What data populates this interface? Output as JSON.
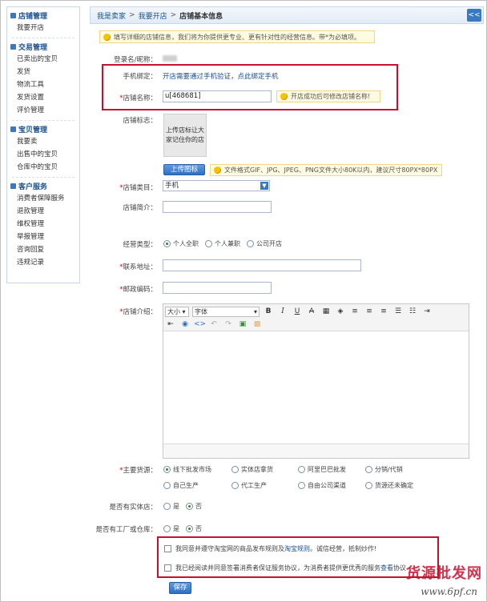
{
  "sidebar": {
    "groups": [
      {
        "title": "店铺管理",
        "items": [
          "我要开店"
        ]
      },
      {
        "title": "交易管理",
        "items": [
          "已卖出的宝贝",
          "发货",
          "物流工具",
          "发货设置",
          "评价管理"
        ]
      },
      {
        "title": "宝贝管理",
        "items": [
          "我要卖",
          "出售中的宝贝",
          "仓库中的宝贝"
        ]
      },
      {
        "title": "客户服务",
        "items": [
          "消费者保障服务",
          "退款管理",
          "维权管理",
          "举报管理",
          "咨询回复",
          "违规记录"
        ]
      }
    ]
  },
  "breadcrumb": {
    "items": [
      "我是卖家",
      "我要开店"
    ],
    "current": "店铺基本信息",
    "separator": ">"
  },
  "collapse_label": "<<",
  "top_tip": "填写详细的店铺信息，我们将为你提供更专业、更有针对性的经营信息。带*为必填项。",
  "form": {
    "login_label": "登录名/昵称：",
    "login_value": "",
    "phone_label": "手机绑定：",
    "phone_text": "开店需要通过手机验证，点此绑定手机",
    "shop_name_label": "店铺名称：",
    "shop_name_value": "u[468681]",
    "shop_name_tip": "开店成功后可修改店铺名称!",
    "logo_label": "店铺标志：",
    "logo_box_text": "上传店标让大家记住你的店",
    "upload_button": "上传图标",
    "upload_tip": "文件格式GIF、JPG、JPEG、PNG文件大小80K以内，建议尺寸80PX*80PX",
    "category_label": "店铺类目：",
    "category_value": "手机",
    "intro_short_label": "店铺简介：",
    "business_type_label": "经营类型：",
    "business_types": [
      "个人全职",
      "个人兼职",
      "公司开店"
    ],
    "address_label": "联系地址：",
    "zip_label": "邮政编码：",
    "shop_intro_label": "店铺介绍：",
    "editor": {
      "size_label": "大小",
      "font_label": "字体"
    },
    "source_label": "主要货源：",
    "sources_row1": [
      "线下批发市场",
      "实体店拿货",
      "阿里巴巴批发",
      "分销/代销"
    ],
    "sources_row2": [
      "自己生产",
      "代工生产",
      "自由公司渠道",
      "货源还未确定"
    ],
    "physical_store_label": "是否有实体店：",
    "factory_label": "是否有工厂或仓库：",
    "yes": "是",
    "no": "否",
    "agree1_a": "我同意并遵守淘宝网的商品发布规则",
    "agree1_b": " 及 ",
    "agree1_c": "淘宝规则",
    "agree1_d": "。诚信经营，抵制炒作!",
    "agree2": "我已经阅读并同意签署消费者保证服务协议，为消费者提供更优秀的服务",
    "agree2_link": "查看",
    "agree2_tail": "协议",
    "save_button": "保存"
  },
  "watermark": {
    "line1": "货源批发网",
    "line2": "www.6pf.cn"
  },
  "colors": {
    "accent": "#3a79c2",
    "link": "#1a4f8f",
    "highlight": "#c8102e",
    "tip_bg": "#fffbe0"
  }
}
